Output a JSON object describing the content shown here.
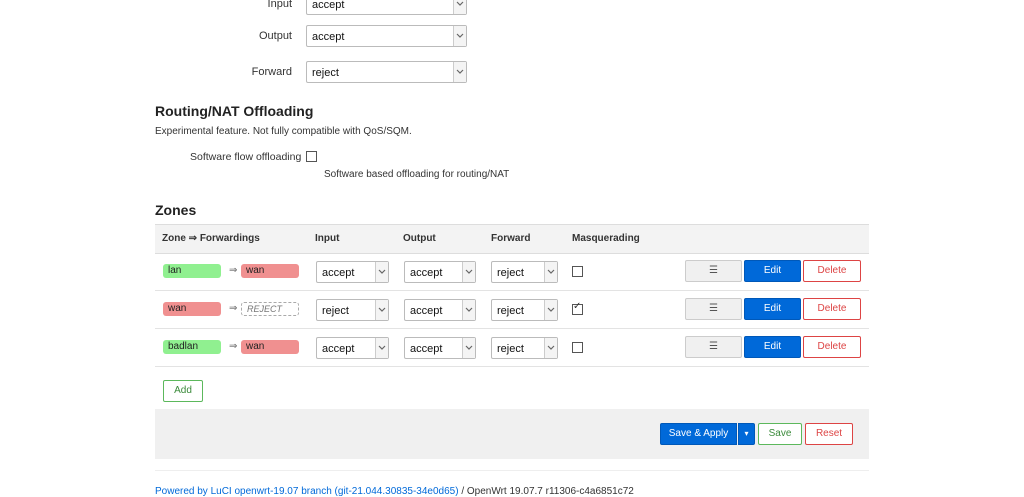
{
  "defaults": {
    "rows": [
      {
        "label": "Input",
        "value": "accept"
      },
      {
        "label": "Output",
        "value": "accept"
      },
      {
        "label": "Forward",
        "value": "reject"
      }
    ]
  },
  "offloading": {
    "title": "Routing/NAT Offloading",
    "description": "Experimental feature. Not fully compatible with QoS/SQM.",
    "flow_label": "Software flow offloading",
    "flow_hint": "Software based offloading for routing/NAT"
  },
  "zones": {
    "title": "Zones",
    "headers": {
      "zone": "Zone ⇒ Forwardings",
      "input": "Input",
      "output": "Output",
      "forward": "Forward",
      "masq": "Masquerading"
    },
    "arrow": "⇒",
    "rows": [
      {
        "zone": "lan",
        "zone_color": "green",
        "fwd": "wan",
        "fwd_color": "red",
        "input": "accept",
        "output": "accept",
        "forward": "reject",
        "masq": false
      },
      {
        "zone": "wan",
        "zone_color": "red",
        "fwd": "REJECT",
        "fwd_color": "reject",
        "input": "reject",
        "output": "accept",
        "forward": "reject",
        "masq": true
      },
      {
        "zone": "badlan",
        "zone_color": "green",
        "fwd": "wan",
        "fwd_color": "red",
        "input": "accept",
        "output": "accept",
        "forward": "reject",
        "masq": false
      }
    ],
    "row_buttons": {
      "drag": "☰",
      "edit": "Edit",
      "delete": "Delete"
    },
    "add_label": "Add"
  },
  "actions": {
    "save_apply": "Save & Apply",
    "save_apply_dropdown": "▾",
    "save": "Save",
    "reset": "Reset"
  },
  "footer": {
    "powered_link": "Powered by LuCI openwrt-19.07 branch (git-21.044.30835-34e0d65)",
    "version": " / OpenWrt 19.07.7 r11306-c4a6851c72"
  }
}
